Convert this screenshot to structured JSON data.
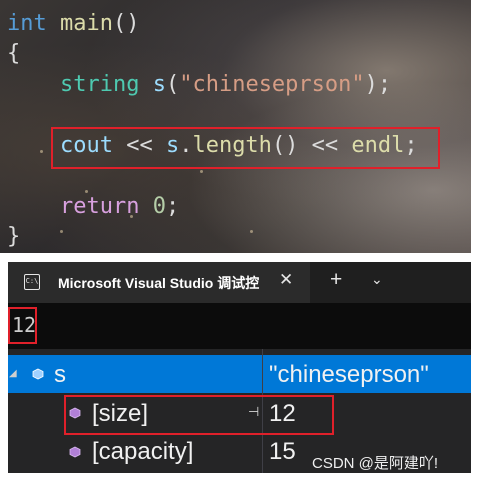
{
  "editor": {
    "lines": {
      "l1": {
        "kw": "int",
        "fn": "main",
        "p": "()"
      },
      "l2": {
        "p": "{"
      },
      "l3": {
        "ty": "string",
        "var": "s",
        "p1": "(",
        "str": "\"chineseprson\"",
        "p2": ");"
      },
      "l4": {
        "var1": "cout",
        "op1": " << ",
        "var2": "s",
        "dot": ".",
        "fn": "length",
        "p": "()",
        "op2": " << ",
        "var3": "endl",
        "semi": ";"
      },
      "l5": {
        "kw": "return",
        "num": "0",
        "semi": ";"
      },
      "l6": {
        "p": "}"
      }
    },
    "highlight_color": "#e0202a"
  },
  "terminal": {
    "tab_icon": "C:\\",
    "tab_title": "Microsoft Visual Studio 调试控",
    "close_glyph": "✕",
    "new_tab_glyph": "+",
    "dropdown_glyph": "⌄",
    "output": "12"
  },
  "watch": {
    "rows": [
      {
        "name": "s",
        "value": "\"chineseprson\"",
        "icon": "variable-icon",
        "selected": true
      },
      {
        "name": "[size]",
        "value": "12",
        "icon": "field-icon",
        "pinned": true
      },
      {
        "name": "[capacity]",
        "value": "15",
        "icon": "field-icon"
      }
    ],
    "selection_color": "#0078d7"
  },
  "watermark": "CSDN @是阿建吖!"
}
